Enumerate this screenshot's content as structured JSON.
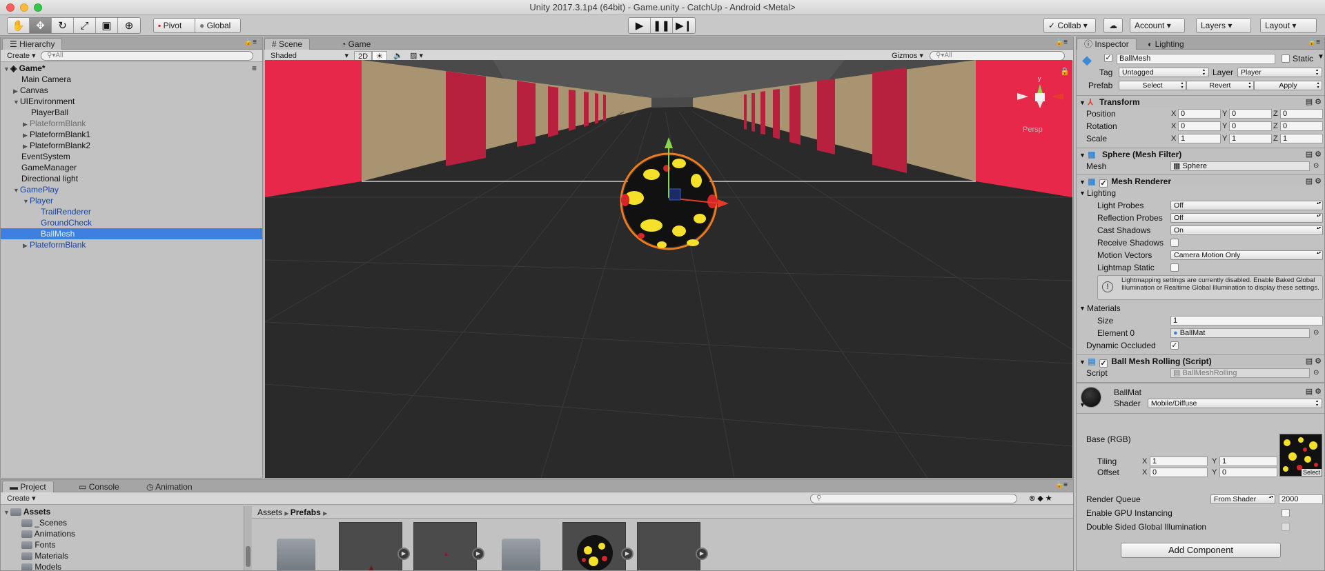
{
  "window_title": "Unity 2017.3.1p4 (64bit) - Game.unity - CatchUp - Android <Metal>",
  "toolbar": {
    "pivot_label": "Pivot",
    "global_label": "Global",
    "collab_label": "Collab",
    "account_label": "Account",
    "layers_label": "Layers",
    "layout_label": "Layout"
  },
  "hierarchy": {
    "tab": "Hierarchy",
    "create": "Create",
    "search_placeholder": "All",
    "scene": "Game*",
    "items": [
      {
        "label": "Main Camera"
      },
      {
        "label": "Canvas"
      },
      {
        "label": "UIEnvironment"
      },
      {
        "label": "PlayerBall"
      },
      {
        "label": "PlateformBlank"
      },
      {
        "label": "PlateformBlank1"
      },
      {
        "label": "PlateformBlank2"
      },
      {
        "label": "EventSystem"
      },
      {
        "label": "GameManager"
      },
      {
        "label": "Directional light"
      },
      {
        "label": "GamePlay"
      },
      {
        "label": "Player"
      },
      {
        "label": "TrailRenderer"
      },
      {
        "label": "GroundCheck"
      },
      {
        "label": "BallMesh"
      },
      {
        "label": "PlateformBlank"
      }
    ]
  },
  "scene_view": {
    "tab_scene": "Scene",
    "tab_game": "Game",
    "shading": "Shaded",
    "mode_2d": "2D",
    "gizmos": "Gizmos",
    "search_placeholder": "All",
    "gizmo_y": "y",
    "gizmo_persp": "Persp"
  },
  "inspector": {
    "tab": "Inspector",
    "tab2": "Lighting",
    "object_name": "BallMesh",
    "static_label": "Static",
    "tag_label": "Tag",
    "tag_value": "Untagged",
    "layer_label": "Layer",
    "layer_value": "Player",
    "prefab_label": "Prefab",
    "prefab_select": "Select",
    "prefab_revert": "Revert",
    "prefab_apply": "Apply",
    "transform": {
      "title": "Transform",
      "position_label": "Position",
      "position": [
        "0",
        "0",
        "0"
      ],
      "rotation_label": "Rotation",
      "rotation": [
        "0",
        "0",
        "0"
      ],
      "scale_label": "Scale",
      "scale": [
        "1",
        "1",
        "1"
      ],
      "x": "X",
      "y": "Y",
      "z": "Z"
    },
    "mesh_filter": {
      "title": "Sphere (Mesh Filter)",
      "mesh_label": "Mesh",
      "mesh_value": "Sphere"
    },
    "mesh_renderer": {
      "title": "Mesh Renderer",
      "lighting": "Lighting",
      "light_probes_label": "Light Probes",
      "light_probes": "Off",
      "reflection_probes_label": "Reflection Probes",
      "reflection_probes": "Off",
      "cast_shadows_label": "Cast Shadows",
      "cast_shadows": "On",
      "receive_shadows_label": "Receive Shadows",
      "motion_vectors_label": "Motion Vectors",
      "motion_vectors": "Camera Motion Only",
      "lightmap_static_label": "Lightmap Static",
      "info": "Lightmapping settings are currently disabled. Enable Baked Global Illumination or Realtime Global Illumination to display these settings.",
      "materials": "Materials",
      "size_label": "Size",
      "size": "1",
      "element0_label": "Element 0",
      "element0": "BallMat",
      "dynamic_occluded_label": "Dynamic Occluded"
    },
    "script_comp": {
      "title": "Ball Mesh Rolling (Script)",
      "script_label": "Script",
      "script_value": "BallMeshRolling"
    },
    "material": {
      "name": "BallMat",
      "shader_label": "Shader",
      "shader": "Mobile/Diffuse",
      "base_label": "Base (RGB)",
      "tiling_label": "Tiling",
      "tiling": [
        "1",
        "1"
      ],
      "offset_label": "Offset",
      "offset": [
        "0",
        "0"
      ],
      "select": "Select",
      "render_queue_label": "Render Queue",
      "render_queue_mode": "From Shader",
      "render_queue": "2000",
      "gpu_instancing_label": "Enable GPU Instancing",
      "double_sided_label": "Double Sided Global Illumination"
    },
    "add_component": "Add Component"
  },
  "project": {
    "tab_project": "Project",
    "tab_console": "Console",
    "tab_animation": "Animation",
    "create": "Create",
    "tree": [
      {
        "label": "Assets"
      },
      {
        "label": "_Scenes"
      },
      {
        "label": "Animations"
      },
      {
        "label": "Fonts"
      },
      {
        "label": "Materials"
      },
      {
        "label": "Models"
      }
    ],
    "breadcrumb_root": "Assets",
    "breadcrumb_current": "Prefabs"
  },
  "colors": {
    "selection": "#3d80df",
    "accent_red": "#e8284a",
    "stripe_tan": "#a89470",
    "floor": "#2b2b2b"
  }
}
